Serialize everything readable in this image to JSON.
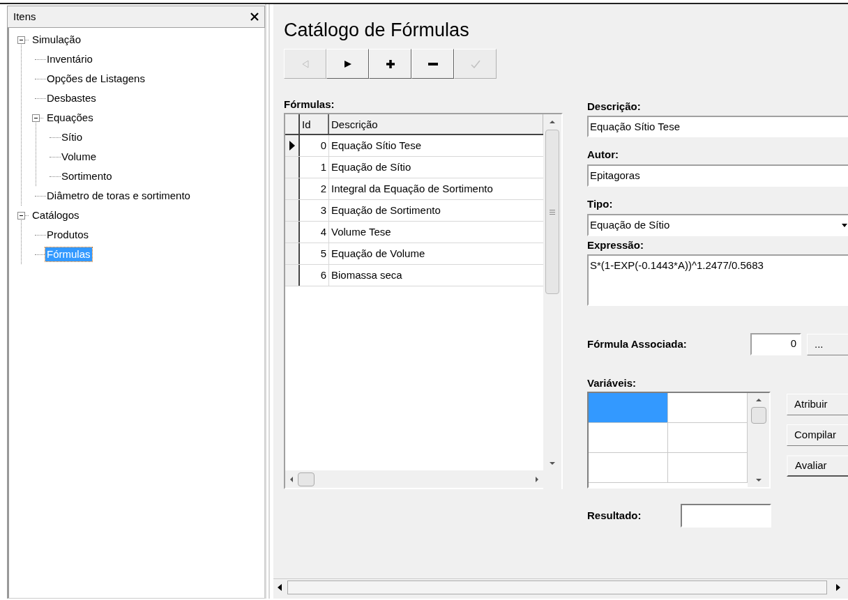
{
  "panel": {
    "title": "Itens"
  },
  "tree": [
    {
      "label": "Simulação",
      "expanded": true,
      "selected": false,
      "children": [
        {
          "label": "Inventário",
          "selected": false
        },
        {
          "label": "Opções de Listagens",
          "selected": false
        },
        {
          "label": "Desbastes",
          "selected": false
        },
        {
          "label": "Equações",
          "expanded": true,
          "selected": false,
          "children": [
            {
              "label": "Sítio",
              "selected": false
            },
            {
              "label": "Volume",
              "selected": false
            },
            {
              "label": "Sortimento",
              "selected": false
            }
          ]
        },
        {
          "label": "Diâmetro de toras e sortimento",
          "selected": false
        }
      ]
    },
    {
      "label": "Catálogos",
      "expanded": true,
      "selected": false,
      "children": [
        {
          "label": "Produtos",
          "selected": false
        },
        {
          "label": "Fórmulas",
          "selected": true
        }
      ]
    }
  ],
  "form": {
    "title": "Catálogo de Fórmulas",
    "toolbar": [
      {
        "kind": "previous",
        "disabled": true
      },
      {
        "kind": "next",
        "disabled": false
      },
      {
        "kind": "add",
        "disabled": false
      },
      {
        "kind": "remove",
        "disabled": false
      },
      {
        "kind": "confirm",
        "disabled": true
      }
    ],
    "formulas": {
      "label": "Fórmulas:",
      "columns": [
        "Id",
        "Descrição"
      ],
      "rows": [
        {
          "id": "0",
          "description": "Equação Sítio Tese",
          "current": true
        },
        {
          "id": "1",
          "description": "Equação de Sítio",
          "current": false
        },
        {
          "id": "2",
          "description": "Integral da Equação de Sortimento",
          "current": false
        },
        {
          "id": "3",
          "description": "Equação de Sortimento",
          "current": false
        },
        {
          "id": "4",
          "description": "Volume Tese",
          "current": false
        },
        {
          "id": "5",
          "description": "Equação de Volume",
          "current": false
        },
        {
          "id": "6",
          "description": "Biomassa seca",
          "current": false
        }
      ]
    },
    "description": {
      "label": "Descrição:",
      "value": "Equação Sítio Tese"
    },
    "author": {
      "label": "Autor:",
      "value": "Epitagoras"
    },
    "type": {
      "label": "Tipo:",
      "value": "Equação de Sítio"
    },
    "expression": {
      "label": "Expressão:",
      "value": "S*(1-EXP(-0.1443*A))^1.2477/0.5683"
    },
    "associated_formula": {
      "label": "Fórmula Associada:",
      "value": "0",
      "button": "..."
    },
    "variables": {
      "label": "Variáveis:",
      "rows": [
        [
          {
            "selected": true
          },
          {
            "selected": false
          }
        ],
        [
          {
            "selected": false
          },
          {
            "selected": false
          }
        ],
        [
          {
            "selected": false
          },
          {
            "selected": false
          }
        ]
      ]
    },
    "buttons": [
      {
        "label": "Atribuir",
        "default": false
      },
      {
        "label": "Compilar",
        "default": false
      },
      {
        "label": "Avaliar",
        "default": true
      }
    ],
    "result": {
      "label": "Resultado:"
    }
  }
}
